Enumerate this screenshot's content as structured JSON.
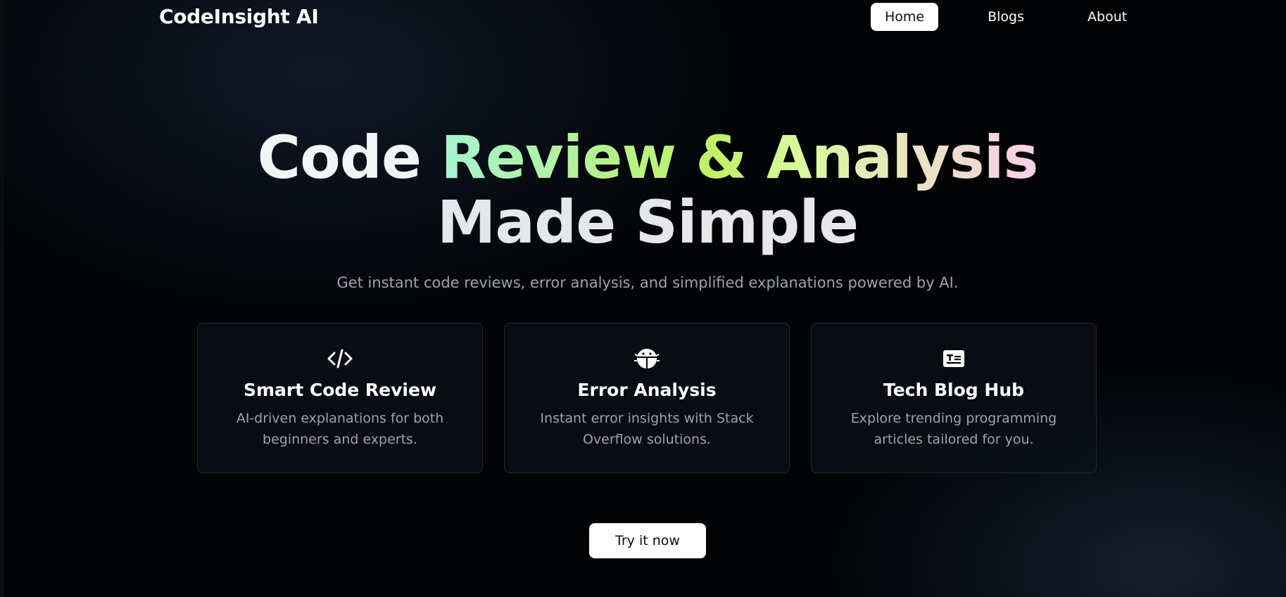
{
  "navbar": {
    "brand": "CodeInsight AI",
    "items": [
      {
        "label": "Home",
        "active": true
      },
      {
        "label": "Blogs",
        "active": false
      },
      {
        "label": "About",
        "active": false
      }
    ]
  },
  "hero": {
    "title_plain": "Code",
    "title_gradient": "Review & Analysis",
    "title_line2": "Made Simple",
    "subtitle": "Get instant code reviews, error analysis, and simplified explanations powered by AI."
  },
  "features": [
    {
      "icon": "code-icon",
      "title": "Smart Code Review",
      "description": "AI-driven explanations for both beginners and experts."
    },
    {
      "icon": "bug-icon",
      "title": "Error Analysis",
      "description": "Instant error insights with Stack Overflow solutions."
    },
    {
      "icon": "newspaper-icon",
      "title": "Tech Blog Hub",
      "description": "Explore trending programming articles tailored for you."
    }
  ],
  "cta": {
    "label": "Try it now"
  },
  "colors": {
    "background": "#020305",
    "card_border": "#1f2937",
    "muted_text": "#9ca3af",
    "gradient_start": "#a7f3d0",
    "gradient_mid": "#bef264",
    "gradient_end": "#fbcfe8"
  }
}
